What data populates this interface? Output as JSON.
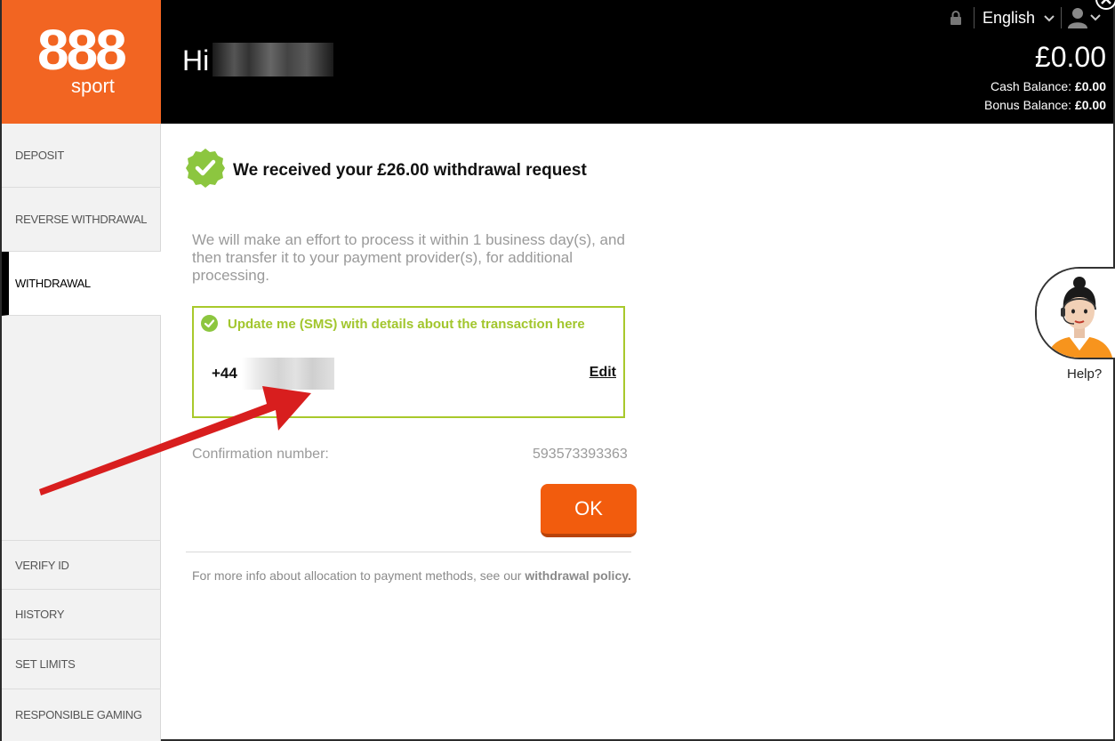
{
  "brand": {
    "logo_main": "888",
    "logo_sub": "sport",
    "accent": "#f26522"
  },
  "header": {
    "greeting": "Hi",
    "language": "English",
    "balance": "£0.00",
    "cash_label": "Cash Balance:",
    "cash_value": "£0.00",
    "bonus_label": "Bonus Balance:",
    "bonus_value": "£0.00"
  },
  "sidebar": {
    "items": [
      {
        "label": "DEPOSIT"
      },
      {
        "label": "REVERSE WITHDRAWAL"
      },
      {
        "label": "WITHDRAWAL",
        "active": true
      },
      {
        "label": "VERIFY ID"
      },
      {
        "label": "HISTORY"
      },
      {
        "label": "SET LIMITS"
      },
      {
        "label": "RESPONSIBLE GAMING"
      }
    ]
  },
  "main": {
    "title": "We received your £26.00 withdrawal request",
    "description": "We will make an effort to process it within 1 business day(s), and then transfer it to your payment provider(s), for additional processing.",
    "sms_label": "Update me (SMS) with details about the transaction here",
    "phone_prefix": "+44",
    "edit_label": "Edit",
    "confirmation_label": "Confirmation number:",
    "confirmation_value": "593573393363",
    "ok_label": "OK",
    "footer_text": "For more info about allocation to payment methods, see our ",
    "footer_link": "withdrawal policy."
  },
  "help": {
    "label": "Help?"
  },
  "colors": {
    "success_green": "#8cc63f",
    "sms_green": "#a2c62d",
    "ok_orange": "#f25c0d",
    "arrow_red": "#d81e1e"
  }
}
